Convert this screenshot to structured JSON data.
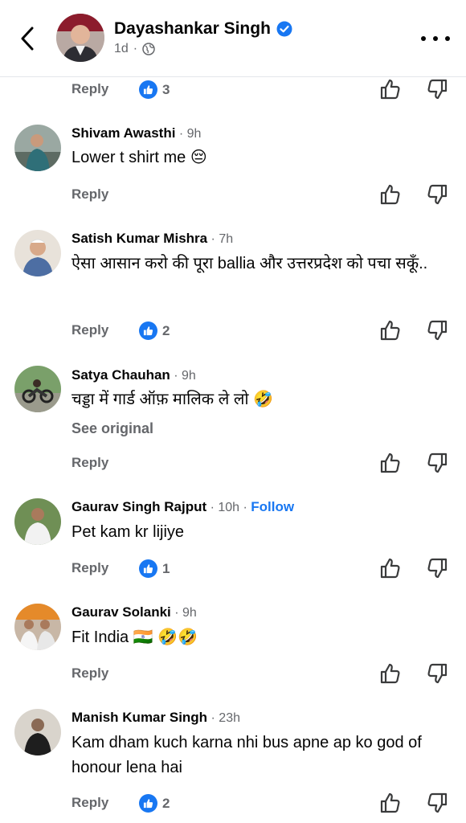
{
  "header": {
    "name": "Dayashankar Singh",
    "time": "1d",
    "dot": "·",
    "icons": {
      "back": "chevron-left-icon",
      "verified": "verified-badge-icon",
      "privacy": "globe-icon",
      "more": "more-dots-icon"
    }
  },
  "labels": {
    "reply": "Reply",
    "see_original": "See original"
  },
  "colors": {
    "accent": "#1877f2",
    "muted": "#65676b",
    "text": "#050505"
  },
  "top_action": {
    "reaction_count": "3"
  },
  "comments": [
    {
      "author": "Shivam Awasthi",
      "meta": " · 9h",
      "text": "Lower t shirt me 😔",
      "reactions": ""
    },
    {
      "author": "Satish Kumar Mishra",
      "meta": " · 7h",
      "text": "ऐसा आसान करो की पूरा ballia और उत्तरप्रदेश को पचा सकूँ..",
      "reactions": "2"
    },
    {
      "author": "Satya Chauhan",
      "meta": " · 9h",
      "text": "चड्डा में गार्ड ऑफ़ मालिक ले लो 🤣",
      "see_original": true,
      "reactions": ""
    },
    {
      "author": "Gaurav Singh Rajput",
      "meta": " · 10h · ",
      "follow": "Follow",
      "text": "Pet kam kr lijiye",
      "reactions": "1"
    },
    {
      "author": "Gaurav Solanki",
      "meta": " · 9h",
      "text": "Fit India 🇮🇳 🤣🤣",
      "reactions": ""
    },
    {
      "author": "Manish Kumar Singh",
      "meta": " · 23h",
      "text": "Kam dham kuch karna nhi bus apne ap ko god of honour lena hai",
      "reactions": "2"
    }
  ]
}
